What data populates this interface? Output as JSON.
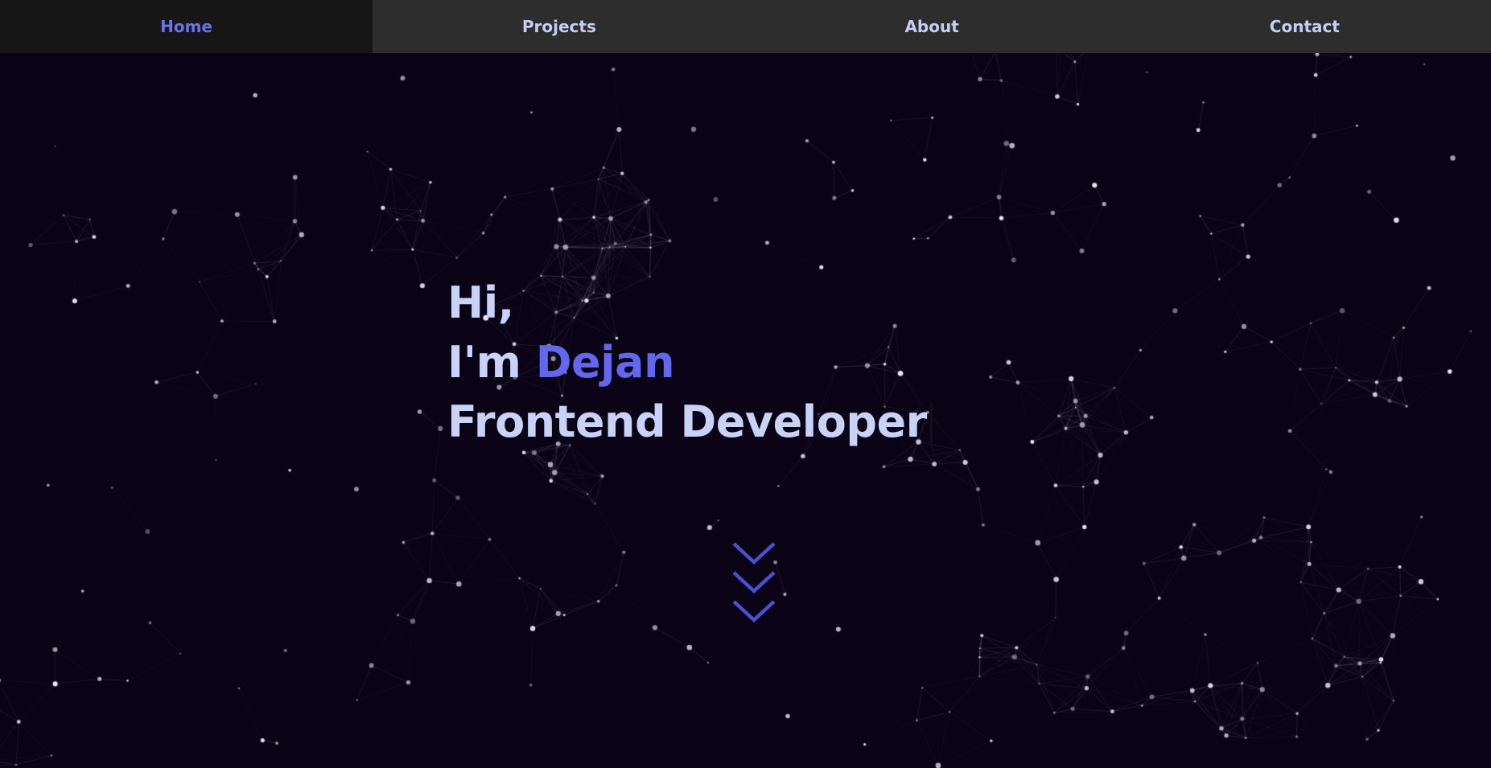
{
  "nav": {
    "items": [
      {
        "label": "Home",
        "active": true
      },
      {
        "label": "Projects",
        "active": false
      },
      {
        "label": "About",
        "active": false
      },
      {
        "label": "Contact",
        "active": false
      }
    ]
  },
  "hero": {
    "greeting": "Hi,",
    "intro_prefix": "I'm ",
    "name": "Dejan",
    "role": "Frontend Developer"
  },
  "colors": {
    "background": "#0a0316",
    "nav_background": "#2d2d2d",
    "nav_active_background": "#161616",
    "nav_active_text": "#6b71ec",
    "text": "#c9d2f7",
    "accent": "#6366ef",
    "chevron": "#4d4dd6",
    "particles": "#ffffff"
  },
  "icons": {
    "scroll_indicator": "triple-chevron-down-icon"
  }
}
